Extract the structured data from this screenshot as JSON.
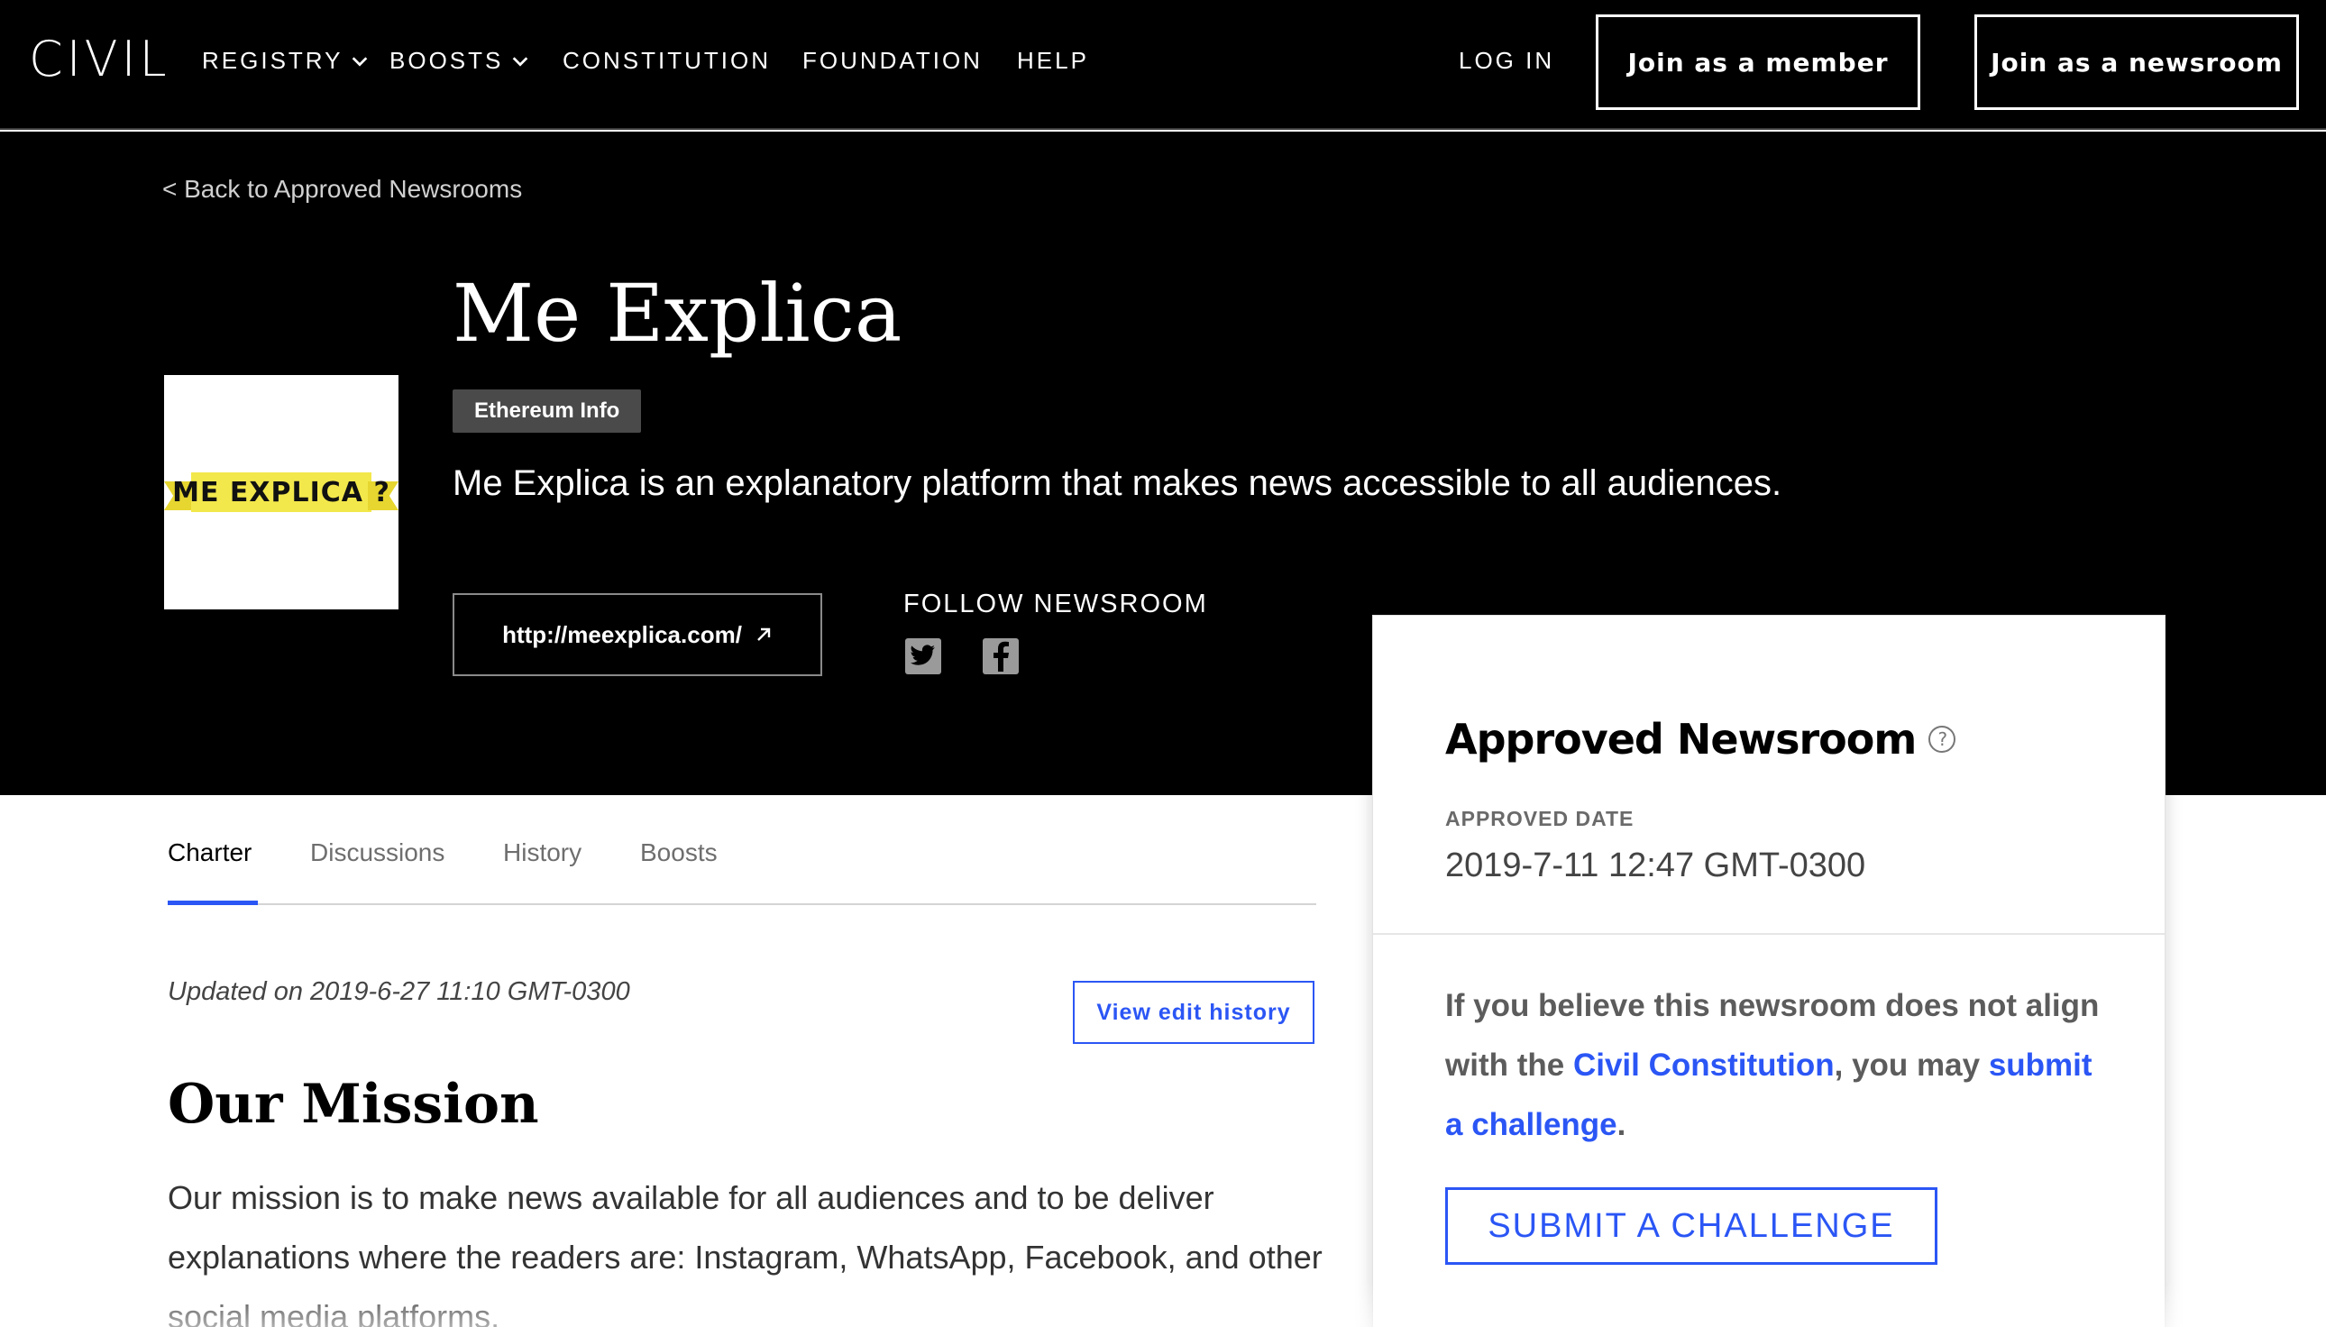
{
  "nav": {
    "logo": "CIVIL",
    "items": [
      {
        "label": "REGISTRY",
        "dropdown": true
      },
      {
        "label": "BOOSTS",
        "dropdown": true
      },
      {
        "label": "CONSTITUTION",
        "dropdown": false
      },
      {
        "label": "FOUNDATION",
        "dropdown": false
      },
      {
        "label": "HELP",
        "dropdown": false
      }
    ],
    "login": "LOG IN",
    "join_member": "Join as a member",
    "join_newsroom": "Join as a newsroom"
  },
  "header": {
    "back_link": "< Back to Approved Newsrooms",
    "title": "Me Explica",
    "badge": "Ethereum Info",
    "tagline": "Me Explica is an explanatory platform that makes news accessible to all audiences.",
    "url": "http://meexplica.com/",
    "follow_label": "FOLLOW NEWSROOM",
    "logo_text": "ME EXPLICA ?",
    "social": [
      "twitter-icon",
      "facebook-icon"
    ]
  },
  "tabs": [
    {
      "label": "Charter",
      "active": true
    },
    {
      "label": "Discussions",
      "active": false
    },
    {
      "label": "History",
      "active": false
    },
    {
      "label": "Boosts",
      "active": false
    }
  ],
  "charter": {
    "updated": "Updated on 2019-6-27 11:10 GMT-0300",
    "edit_history": "View edit history",
    "mission_heading": "Our Mission",
    "mission_body": "Our mission is to make news available for all audiences and to be deliver explanations where the readers are: Instagram, WhatsApp, Facebook, and other social media platforms."
  },
  "status_card": {
    "title": "Approved Newsroom",
    "approved_label": "APPROVED DATE",
    "approved_date": "2019-7-11 12:47 GMT-0300",
    "challenge_prefix": "If you believe this newsroom does not align with the ",
    "constitution_link": "Civil Constitution",
    "challenge_middle": ", you may ",
    "submit_link": "submit a challenge",
    "challenge_suffix": ".",
    "challenge_button": "SUBMIT A CHALLENGE"
  },
  "colors": {
    "accent": "#2b56f5",
    "header_bg": "#000000",
    "badge_bg": "#4a4a4a",
    "logo_banner": "#f3e84b"
  }
}
